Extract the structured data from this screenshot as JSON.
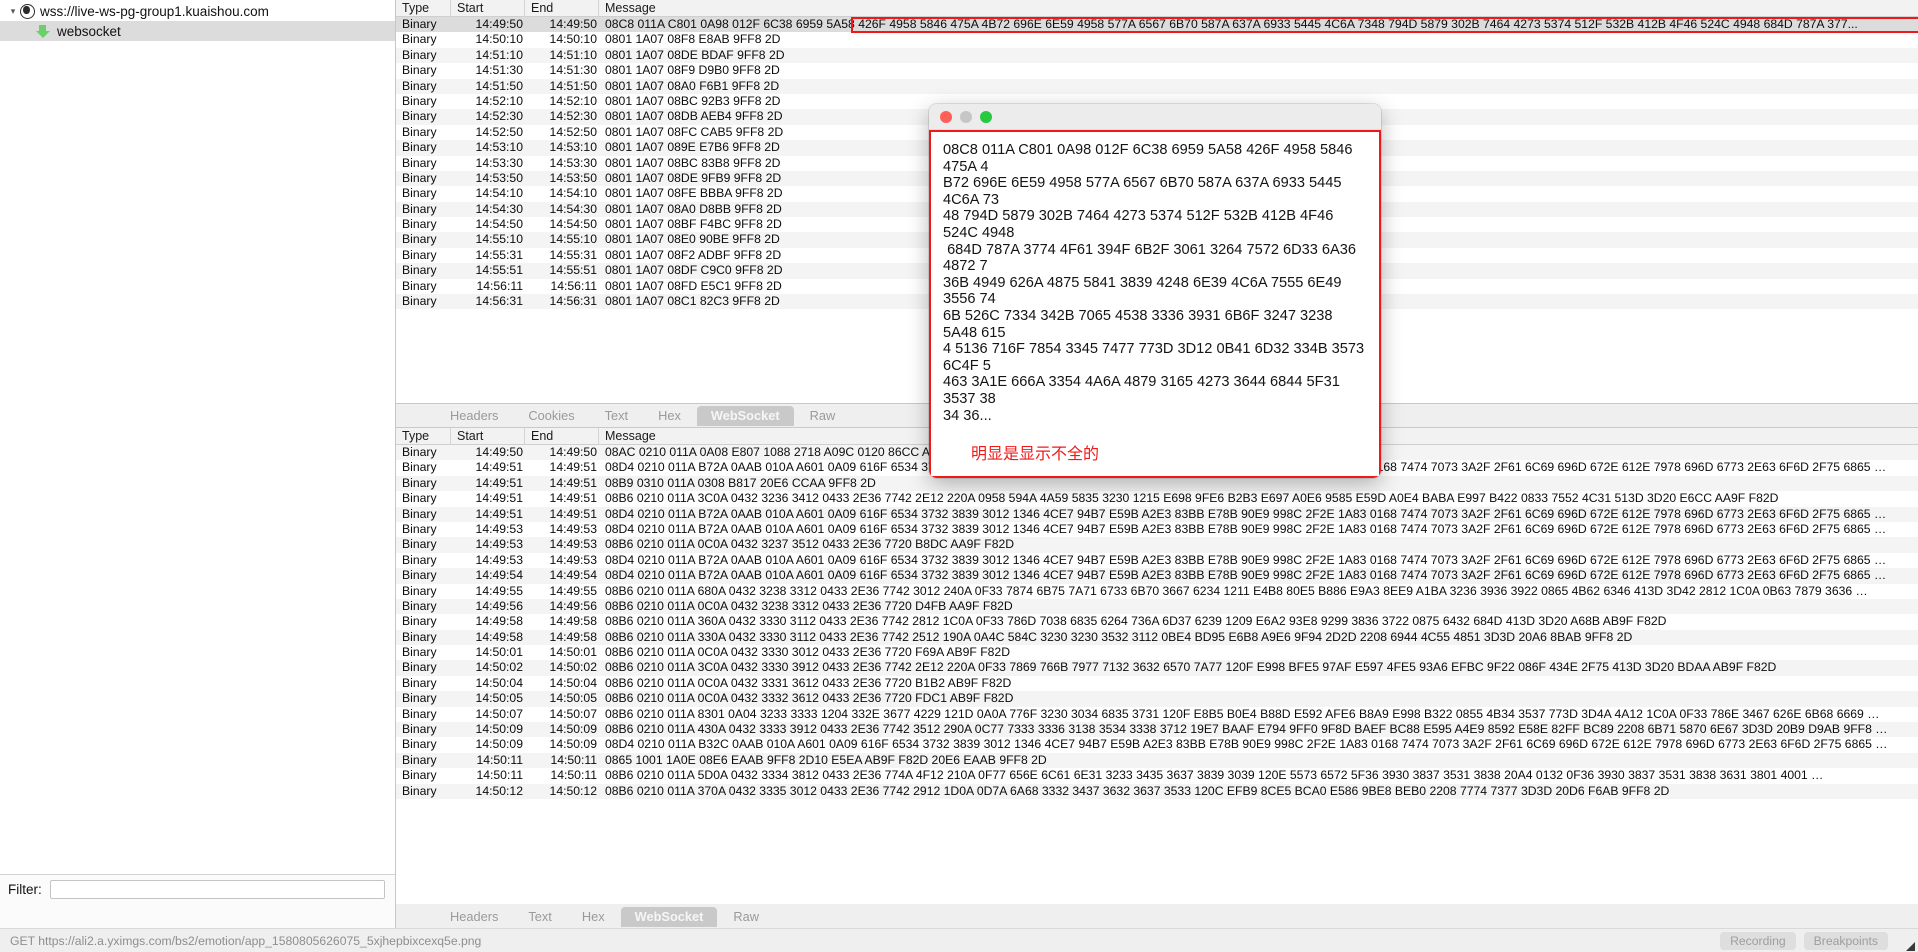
{
  "sidebar": {
    "tree": [
      {
        "label": "wss://live-ws-pg-group1.kuaishou.com",
        "icon": "globe-icon",
        "twisty": "⌄",
        "level": 0,
        "selected": false
      },
      {
        "label": "websocket",
        "icon": "arrow-down-icon",
        "level": 1,
        "selected": true
      }
    ],
    "filter": {
      "label": "Filter:",
      "value": "",
      "placeholder": ""
    }
  },
  "top_table": {
    "columns": [
      "Type",
      "Start",
      "End",
      "Message"
    ],
    "rows": [
      {
        "type": "Binary",
        "start": "14:49:50",
        "end": "14:49:50",
        "msg": "08C8 011A C801 0A98 012F 6C38 6959 5A58 426F 4958 5846 475A 4B72 696E 6E59 4958 577A 6567 6B70 587A 637A 6933 5445 4C6A 7348 794D 5879 302B 7464 4273 5374 512F 532B 412B 4F46 524C 4948 684D 787A 377...",
        "selected": true
      },
      {
        "type": "Binary",
        "start": "14:50:10",
        "end": "14:50:10",
        "msg": "0801 1A07 08F8 E8AB 9FF8 2D"
      },
      {
        "type": "Binary",
        "start": "14:51:10",
        "end": "14:51:10",
        "msg": "0801 1A07 08DE BDAF 9FF8 2D"
      },
      {
        "type": "Binary",
        "start": "14:51:30",
        "end": "14:51:30",
        "msg": "0801 1A07 08F9 D9B0 9FF8 2D"
      },
      {
        "type": "Binary",
        "start": "14:51:50",
        "end": "14:51:50",
        "msg": "0801 1A07 08A0 F6B1 9FF8 2D"
      },
      {
        "type": "Binary",
        "start": "14:52:10",
        "end": "14:52:10",
        "msg": "0801 1A07 08BC 92B3 9FF8 2D"
      },
      {
        "type": "Binary",
        "start": "14:52:30",
        "end": "14:52:30",
        "msg": "0801 1A07 08DB AEB4 9FF8 2D"
      },
      {
        "type": "Binary",
        "start": "14:52:50",
        "end": "14:52:50",
        "msg": "0801 1A07 08FC CAB5 9FF8 2D"
      },
      {
        "type": "Binary",
        "start": "14:53:10",
        "end": "14:53:10",
        "msg": "0801 1A07 089E E7B6 9FF8 2D"
      },
      {
        "type": "Binary",
        "start": "14:53:30",
        "end": "14:53:30",
        "msg": "0801 1A07 08BC 83B8 9FF8 2D"
      },
      {
        "type": "Binary",
        "start": "14:53:50",
        "end": "14:53:50",
        "msg": "0801 1A07 08DE 9FB9 9FF8 2D"
      },
      {
        "type": "Binary",
        "start": "14:54:10",
        "end": "14:54:10",
        "msg": "0801 1A07 08FE BBBA 9FF8 2D"
      },
      {
        "type": "Binary",
        "start": "14:54:30",
        "end": "14:54:30",
        "msg": "0801 1A07 08A0 D8BB 9FF8 2D"
      },
      {
        "type": "Binary",
        "start": "14:54:50",
        "end": "14:54:50",
        "msg": "0801 1A07 08BF F4BC 9FF8 2D"
      },
      {
        "type": "Binary",
        "start": "14:55:10",
        "end": "14:55:10",
        "msg": "0801 1A07 08E0 90BE 9FF8 2D"
      },
      {
        "type": "Binary",
        "start": "14:55:31",
        "end": "14:55:31",
        "msg": "0801 1A07 08F2 ADBF 9FF8 2D"
      },
      {
        "type": "Binary",
        "start": "14:55:51",
        "end": "14:55:51",
        "msg": "0801 1A07 08DF C9C0 9FF8 2D"
      },
      {
        "type": "Binary",
        "start": "14:56:11",
        "end": "14:56:11",
        "msg": "0801 1A07 08FD E5C1 9FF8 2D"
      },
      {
        "type": "Binary",
        "start": "14:56:31",
        "end": "14:56:31",
        "msg": "0801 1A07 08C1 82C3 9FF8 2D"
      }
    ]
  },
  "upper_tabs": {
    "items": [
      "Headers",
      "Cookies",
      "Text",
      "Hex",
      "WebSocket",
      "Raw"
    ],
    "active": "WebSocket"
  },
  "bottom_table": {
    "columns": [
      "Type",
      "Start",
      "End",
      "Message"
    ],
    "rows": [
      {
        "type": "Binary",
        "start": "14:49:50",
        "end": "14:49:50",
        "msg": "08AC 0210 011A 0A08 E807 1088 2718 A09C 0120 86CC AA9F F82D"
      },
      {
        "type": "Binary",
        "start": "14:49:51",
        "end": "14:49:51",
        "msg": "08D4 0210 011A B72A 0AAB 010A A601 0A09 616F 6534 3732 3839 3012 1346 4CE7 94B7 E59B A2E3 83BB E78B 90E9 998C 2F2E 1A83 0168 7474 7073 3A2F 2F61 6C69 696D 672E 612E 7978 696D 6773 2E63 6F6D 2F75 6865 …"
      },
      {
        "type": "Binary",
        "start": "14:49:51",
        "end": "14:49:51",
        "msg": "08B9 0310 011A 0308 B817 20E6 CCAA 9FF8 2D"
      },
      {
        "type": "Binary",
        "start": "14:49:51",
        "end": "14:49:51",
        "msg": "08B6 0210 011A 3C0A 0432 3236 3412 0433 2E36 7742 2E12 220A 0958 594A 4A59 5835 3230 1215 E698 9FE6 B2B3 E697 A0E6 9585 E59D A0E4 BABA E997 B422 0833 7552 4C31 513D 3D20 E6CC AA9F F82D"
      },
      {
        "type": "Binary",
        "start": "14:49:51",
        "end": "14:49:51",
        "msg": "08D4 0210 011A B72A 0AAB 010A A601 0A09 616F 6534 3732 3839 3012 1346 4CE7 94B7 E59B A2E3 83BB E78B 90E9 998C 2F2E 1A83 0168 7474 7073 3A2F 2F61 6C69 696D 672E 612E 7978 696D 6773 2E63 6F6D 2F75 6865 …"
      },
      {
        "type": "Binary",
        "start": "14:49:53",
        "end": "14:49:53",
        "msg": "08D4 0210 011A B72A 0AAB 010A A601 0A09 616F 6534 3732 3839 3012 1346 4CE7 94B7 E59B A2E3 83BB E78B 90E9 998C 2F2E 1A83 0168 7474 7073 3A2F 2F61 6C69 696D 672E 612E 7978 696D 6773 2E63 6F6D 2F75 6865 …"
      },
      {
        "type": "Binary",
        "start": "14:49:53",
        "end": "14:49:53",
        "msg": "08B6 0210 011A 0C0A 0432 3237 3512 0433 2E36 7720 B8DC AA9F F82D"
      },
      {
        "type": "Binary",
        "start": "14:49:53",
        "end": "14:49:53",
        "msg": "08D4 0210 011A B72A 0AAB 010A A601 0A09 616F 6534 3732 3839 3012 1346 4CE7 94B7 E59B A2E3 83BB E78B 90E9 998C 2F2E 1A83 0168 7474 7073 3A2F 2F61 6C69 696D 672E 612E 7978 696D 6773 2E63 6F6D 2F75 6865 …"
      },
      {
        "type": "Binary",
        "start": "14:49:54",
        "end": "14:49:54",
        "msg": "08D4 0210 011A B72A 0AAB 010A A601 0A09 616F 6534 3732 3839 3012 1346 4CE7 94B7 E59B A2E3 83BB E78B 90E9 998C 2F2E 1A83 0168 7474 7073 3A2F 2F61 6C69 696D 672E 612E 7978 696D 6773 2E63 6F6D 2F75 6865 …"
      },
      {
        "type": "Binary",
        "start": "14:49:55",
        "end": "14:49:55",
        "msg": "08B6 0210 011A 680A 0432 3238 3312 0433 2E36 7742 3012 240A 0F33 7874 6B75 7A71 6733 6B70 3667 6234 1211 E4B8 80E5 B886 E9A3 8EE9 A1BA 3236 3936 3922 0865 4B62 6346 413D 3D42 2812 1C0A 0B63 7879 3636 …"
      },
      {
        "type": "Binary",
        "start": "14:49:56",
        "end": "14:49:56",
        "msg": "08B6 0210 011A 0C0A 0432 3238 3312 0433 2E36 7720 D4FB AA9F F82D"
      },
      {
        "type": "Binary",
        "start": "14:49:58",
        "end": "14:49:58",
        "msg": "08B6 0210 011A 360A 0432 3330 3112 0433 2E36 7742 2812 1C0A 0F33 786D 7038 6835 6264 736A 6D37 6239 1209 E6A2 93E8 9299 3836 3722 0875 6432 684D 413D 3D20 A68B AB9F F82D"
      },
      {
        "type": "Binary",
        "start": "14:49:58",
        "end": "14:49:58",
        "msg": "08B6 0210 011A 330A 0432 3330 3112 0433 2E36 7742 2512 190A 0A4C 584C 3230 3230 3532 3112 0BE4 BD95 E6B8 A9E6 9F94 2D2D 2208 6944 4C55 4851 3D3D 20A6 8BAB 9FF8 2D"
      },
      {
        "type": "Binary",
        "start": "14:50:01",
        "end": "14:50:01",
        "msg": "08B6 0210 011A 0C0A 0432 3330 3012 0433 2E36 7720 F69A AB9F F82D"
      },
      {
        "type": "Binary",
        "start": "14:50:02",
        "end": "14:50:02",
        "msg": "08B6 0210 011A 3C0A 0432 3330 3912 0433 2E36 7742 2E12 220A 0F33 7869 766B 7977 7132 3632 6570 7A77 120F E998 BFE5 97AF E597 4FE5 93A6 EFBC 9F22 086F 434E 2F75 413D 3D20 BDAA AB9F F82D"
      },
      {
        "type": "Binary",
        "start": "14:50:04",
        "end": "14:50:04",
        "msg": "08B6 0210 011A 0C0A 0432 3331 3612 0433 2E36 7720 B1B2 AB9F F82D"
      },
      {
        "type": "Binary",
        "start": "14:50:05",
        "end": "14:50:05",
        "msg": "08B6 0210 011A 0C0A 0432 3332 3612 0433 2E36 7720 FDC1 AB9F F82D"
      },
      {
        "type": "Binary",
        "start": "14:50:07",
        "end": "14:50:07",
        "msg": "08B6 0210 011A 8301 0A04 3233 3333 1204 332E 3677 4229 121D 0A0A 776F 3230 3034 6835 3731 120F E8B5 B0E4 B88D E592 AFE6 B8A9 E998 B322 0855 4B34 3537 773D 3D4A 4A12 1C0A 0F33 786E 3467 626E 6B68 6669 …"
      },
      {
        "type": "Binary",
        "start": "14:50:09",
        "end": "14:50:09",
        "msg": "08B6 0210 011A 430A 0432 3333 3912 0433 2E36 7742 3512 290A 0C77 7333 3336 3138 3534 3338 3712 19E7 BAAF E794 9FF0 9F8D BAEF BC88 E595 A4E9 8592 E58E 82FF BC89 2208 6B71 5870 6E67 3D3D 20B9 D9AB 9FF8 …"
      },
      {
        "type": "Binary",
        "start": "14:50:09",
        "end": "14:50:09",
        "msg": "08D4 0210 011A B32C 0AAB 010A A601 0A09 616F 6534 3732 3839 3012 1346 4CE7 94B7 E59B A2E3 83BB E78B 90E9 998C 2F2E 1A83 0168 7474 7073 3A2F 2F61 6C69 696D 672E 612E 7978 696D 6773 2E63 6F6D 2F75 6865 …"
      },
      {
        "type": "Binary",
        "start": "14:50:11",
        "end": "14:50:11",
        "msg": "0865 1001 1A0E 08E6 EAAB 9FF8 2D10 E5EA AB9F F82D 20E6 EAAB 9FF8 2D"
      },
      {
        "type": "Binary",
        "start": "14:50:11",
        "end": "14:50:11",
        "msg": "08B6 0210 011A 5D0A 0432 3334 3812 0433 2E36 774A 4F12 210A 0F77 656E 6C61 6E31 3233 3435 3637 3839 3039 120E 5573 6572 5F36 3930 3837 3531 3838 20A4 0132 0F36 3930 3837 3531 3838 3631 3801 4001 …"
      },
      {
        "type": "Binary",
        "start": "14:50:12",
        "end": "14:50:12",
        "msg": "08B6 0210 011A 370A 0432 3335 3012 0433 2E36 7742 2912 1D0A 0D7A 6A68 3332 3437 3632 3637 3533 120C EFB9 8CE5 BCA0 E586 9BE8 BEB0 2208 7774 7377 3D3D 20D6 F6AB 9FF8 2D"
      }
    ]
  },
  "lower_tabs": {
    "items": [
      "Headers",
      "Text",
      "Hex",
      "WebSocket",
      "Raw"
    ],
    "active": "WebSocket"
  },
  "popup": {
    "traffic_lights": [
      "close",
      "minimize",
      "zoom"
    ],
    "hex": "08C8 011A C801 0A98 012F 6C38 6959 5A58 426F 4958 5846 475A 4\nB72 696E 6E59 4958 577A 6567 6B70 587A 637A 6933 5445 4C6A 73\n48 794D 5879 302B 7464 4273 5374 512F 532B 412B 4F46 524C 4948\n 684D 787A 3774 4F61 394F 6B2F 3061 3264 7572 6D33 6A36 4872 7\n36B 4949 626A 4875 5841 3839 4248 6E39 4C6A 7555 6E49 3556 74\n6B 526C 7334 342B 7065 4538 3336 3931 6B6F 3247 3238 5A48 615\n4 5136 716F 7854 3345 7477 773D 3D12 0B41 6D32 334B 3573 6C4F 5\n463 3A1E 666A 3354 4A6A 4879 3165 4273 3644 6844 5F31 3537 38\n34 36...",
    "note": "明显是显示不全的"
  },
  "statusbar": {
    "url": "GET https://ali2.a.yximgs.com/bs2/emotion/app_1580805626075_5xjhepbixcexq5e.png",
    "recording_label": "Recording",
    "breakpoints_label": "Breakpoints"
  }
}
